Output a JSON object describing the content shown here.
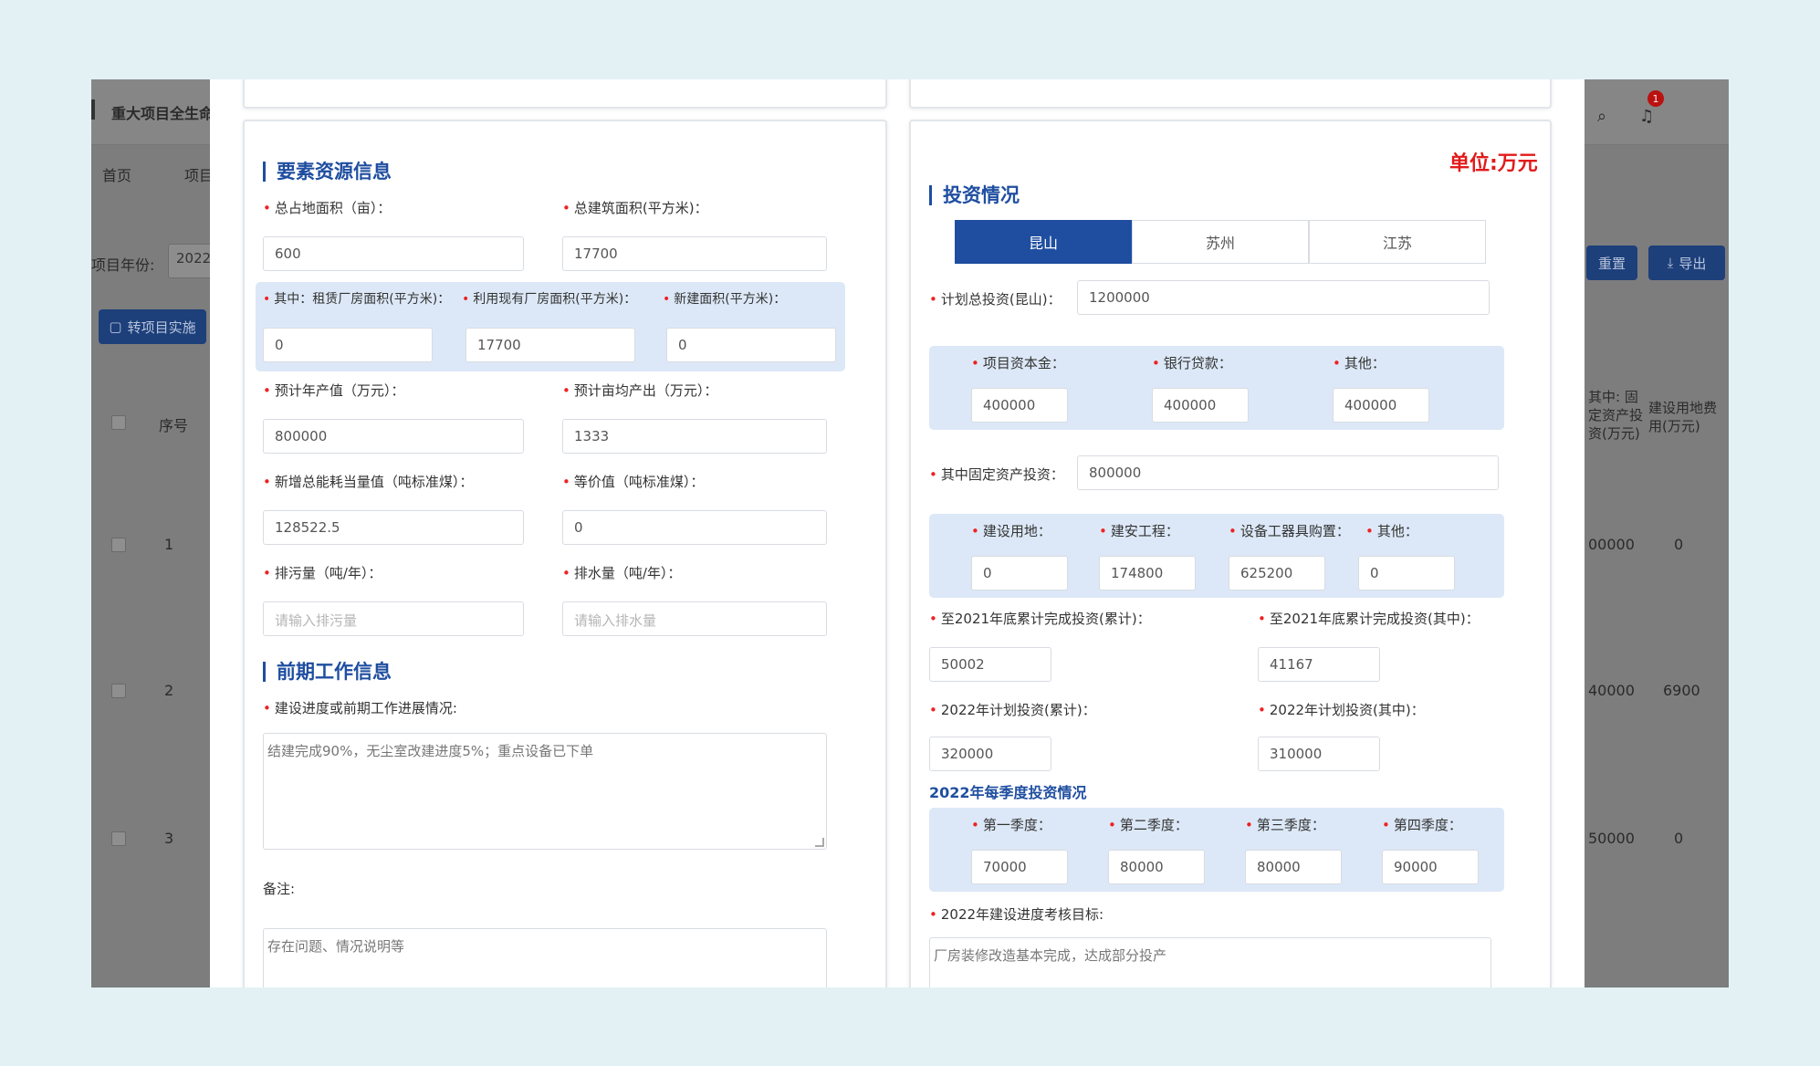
{
  "background": {
    "app_title": "重大项目全生命",
    "nav": [
      "首页",
      "项目"
    ],
    "year_label": "项目年份:",
    "year_value": "2022",
    "action_button": "转项目实施",
    "reset_button": "重置",
    "export_button": "导出",
    "notification_count": "1",
    "table": {
      "headers": [
        "序号",
        "其中: 固定资产投资(万元)",
        "建设用地费用(万元)"
      ],
      "rows": [
        {
          "index": "1",
          "fixed": "00000",
          "land": "0"
        },
        {
          "index": "2",
          "fixed": "40000",
          "land": "6900"
        },
        {
          "index": "3",
          "fixed": "50000",
          "land": "0"
        }
      ]
    }
  },
  "left_panel": {
    "resource_title": "要素资源信息",
    "fields": {
      "total_land_label": "总占地面积（亩）：",
      "total_land_value": "600",
      "total_building_label": "总建筑面积(平方米)：",
      "total_building_value": "17700",
      "leased_label": "其中：租赁厂房面积(平方米)：",
      "leased_value": "0",
      "existing_label": "利用现有厂房面积(平方米)：",
      "existing_value": "17700",
      "new_label": "新建面积(平方米)：",
      "new_value": "0",
      "annual_output_label": "预计年产值（万元）：",
      "annual_output_value": "800000",
      "per_mu_label": "预计亩均产出（万元）：",
      "per_mu_value": "1333",
      "energy_label": "新增总能耗当量值（吨标准煤）：",
      "energy_value": "128522.5",
      "equivalent_label": "等价值（吨标准煤）：",
      "equivalent_value": "0",
      "emission_label": "排污量（吨/年）：",
      "emission_placeholder": "请输入排污量",
      "water_label": "排水量（吨/年）：",
      "water_placeholder": "请输入排水量"
    },
    "prework_title": "前期工作信息",
    "progress_label": "建设进度或前期工作进展情况:",
    "progress_value": "结建完成90%，无尘室改建进度5%；重点设备已下单",
    "remark_label": "备注:",
    "remark_value": "存在问题、情况说明等"
  },
  "right_panel": {
    "unit_text": "单位:万元",
    "invest_title": "投资情况",
    "tabs": [
      "昆山",
      "苏州",
      "江苏"
    ],
    "active_tab": 0,
    "plan_total_label": "计划总投资(昆山)：",
    "plan_total_value": "1200000",
    "capital": {
      "own_label": "项目资本金：",
      "own_value": "400000",
      "loan_label": "银行贷款：",
      "loan_value": "400000",
      "other_label": "其他：",
      "other_value": "400000"
    },
    "fixed_label": "其中固定资产投资：",
    "fixed_value": "800000",
    "fixed_breakdown": {
      "land_label": "建设用地：",
      "land_value": "0",
      "construction_label": "建安工程：",
      "construction_value": "174800",
      "equipment_label": "设备工器具购置：",
      "equipment_value": "625200",
      "other_label": "其他：",
      "other_value": "0"
    },
    "cum_total_label": "至2021年底累计完成投资(累计)：",
    "cum_total_value": "50002",
    "cum_fixed_label": "至2021年底累计完成投资(其中)：",
    "cum_fixed_value": "41167",
    "plan2022_total_label": "2022年计划投资(累计)：",
    "plan2022_total_value": "320000",
    "plan2022_fixed_label": "2022年计划投资(其中)：",
    "plan2022_fixed_value": "310000",
    "quarterly_title": "2022年每季度投资情况",
    "quarters": {
      "q1_label": "第一季度：",
      "q1_value": "70000",
      "q2_label": "第二季度：",
      "q2_value": "80000",
      "q3_label": "第三季度：",
      "q3_value": "80000",
      "q4_label": "第四季度：",
      "q4_value": "90000"
    },
    "target_label": "2022年建设进度考核目标:",
    "target_value": "厂房装修改造基本完成，达成部分投产"
  }
}
